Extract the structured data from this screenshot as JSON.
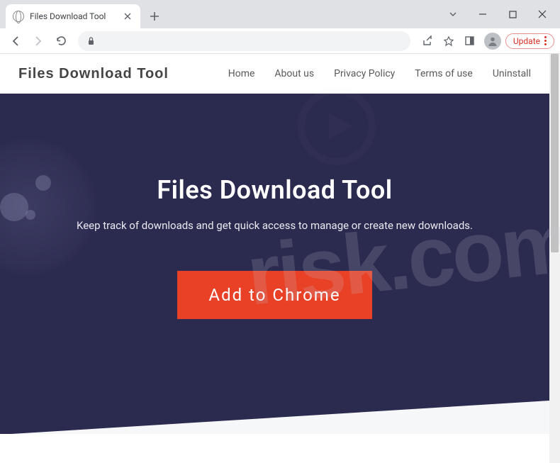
{
  "browser": {
    "tab_title": "Files Download Tool",
    "update_label": "Update"
  },
  "site": {
    "logo": "Files Download Tool",
    "nav": [
      "Home",
      "About us",
      "Privacy Policy",
      "Terms of use",
      "Uninstall"
    ]
  },
  "hero": {
    "title": "Files Download Tool",
    "subtitle": "Keep track of downloads and get quick access to manage or create new downloads.",
    "cta": "Add to Chrome"
  }
}
